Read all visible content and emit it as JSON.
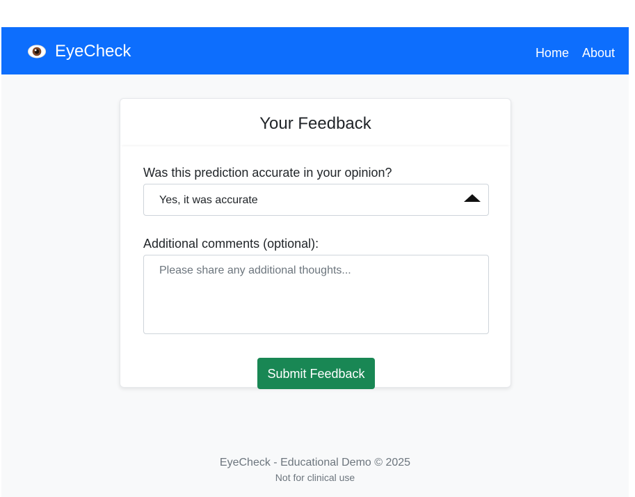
{
  "navbar": {
    "brand_icon": "eye-icon",
    "brand": "EyeCheck",
    "links": [
      {
        "label": "Home"
      },
      {
        "label": "About"
      }
    ],
    "background_color": "#0d6efd"
  },
  "feedback_card": {
    "title": "Your Feedback",
    "accuracy_label": "Was this prediction accurate in your opinion?",
    "accuracy_select": {
      "selected": "Yes, it was accurate",
      "arrow_icon": "caret-up-icon"
    },
    "comments_label": "Additional comments (optional):",
    "comments_placeholder": "Please share any additional thoughts...",
    "comments_value": "",
    "submit_label": "Submit Feedback",
    "submit_color": "#198754"
  },
  "footer": {
    "main": "EyeCheck - Educational Demo © 2025",
    "sub": "Not for clinical use"
  }
}
